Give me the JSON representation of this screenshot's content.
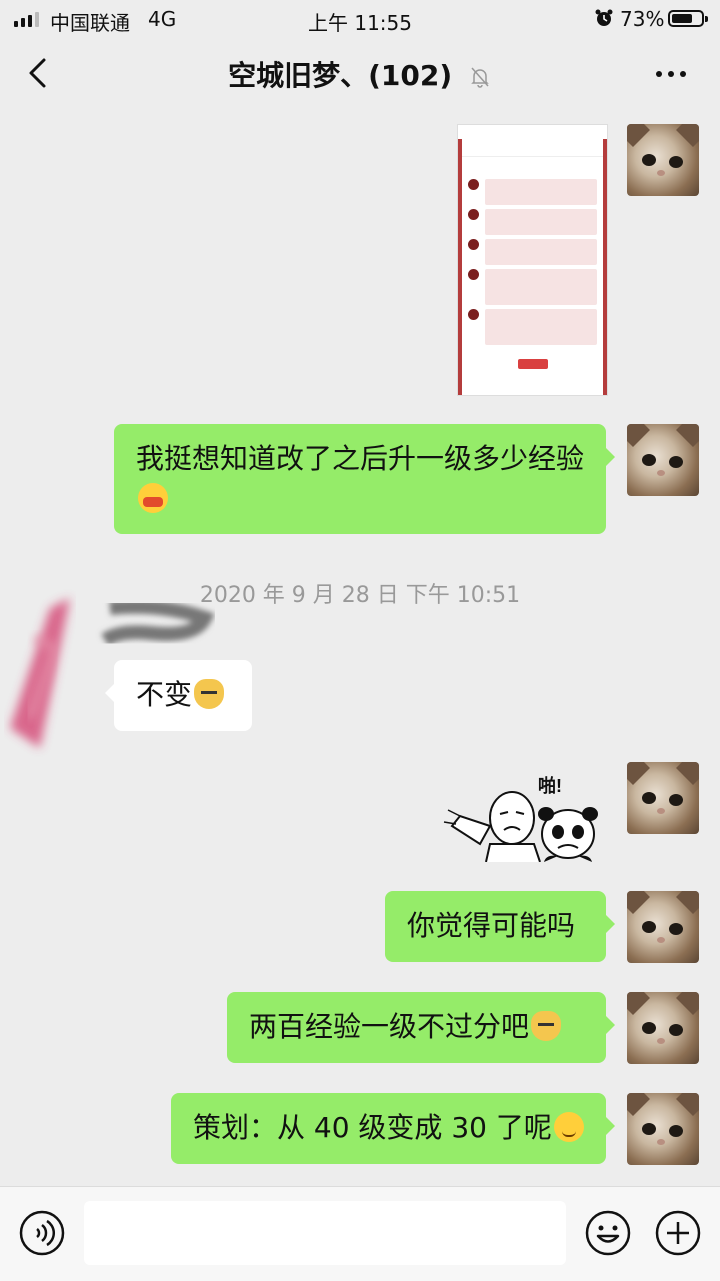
{
  "status_bar": {
    "carrier": "中国联通",
    "network": "4G",
    "time": "上午 11:55",
    "battery_percent": "73%",
    "battery_level": 0.73
  },
  "header": {
    "title": "空城旧梦、(102)",
    "back_icon": "chevron-left-icon",
    "mute_icon": "bell-muted-icon",
    "more_icon": "more-dots-icon"
  },
  "messages": {
    "m1_text": "我挺想知道改了之后升一级多少经验",
    "timestamp": "2020 年 9 月 28 日 下午 10:51",
    "m2_text": "不变",
    "sticker_text": "啪!",
    "m3_text": "你觉得可能吗",
    "m4_text": "两百经验一级不过分吧",
    "m5_text": "策划：从 40 级变成 30 了呢"
  },
  "input_bar": {
    "voice_icon": "voice-icon",
    "emoji_icon": "emoji-icon",
    "plus_icon": "plus-icon"
  },
  "colors": {
    "outgoing_bubble": "#95ec69",
    "incoming_bubble": "#ffffff",
    "background": "#ededed"
  }
}
